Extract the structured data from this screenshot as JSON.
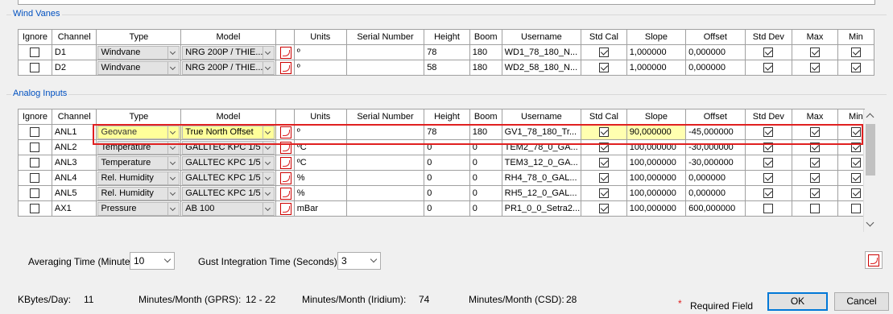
{
  "colors": {
    "highlight": "#e02020",
    "group_title": "#0050c0",
    "cell_yellow": "#ffff9a"
  },
  "wind_vanes": {
    "title": "Wind Vanes",
    "headers": [
      "Ignore",
      "Channel",
      "Type",
      "Model",
      "",
      "Units",
      "Serial Number",
      "Height",
      "Boom",
      "Username",
      "Std Cal",
      "Slope",
      "Offset",
      "Std Dev",
      "Max",
      "Min"
    ],
    "rows": [
      {
        "ignore": false,
        "channel": "D1",
        "type": "Windvane",
        "model": "NRG 200P / THIE...",
        "units": "º",
        "serial": "",
        "height": "78",
        "boom": "180",
        "username": "WD1_78_180_N...",
        "std_cal": true,
        "slope": "1,000000",
        "offset": "0,000000",
        "std_dev": true,
        "max": true,
        "min": true
      },
      {
        "ignore": false,
        "channel": "D2",
        "type": "Windvane",
        "model": "NRG 200P / THIE...",
        "units": "º",
        "serial": "",
        "height": "58",
        "boom": "180",
        "username": "WD2_58_180_N...",
        "std_cal": true,
        "slope": "1,000000",
        "offset": "0,000000",
        "std_dev": true,
        "max": true,
        "min": true
      }
    ]
  },
  "analog_inputs": {
    "title": "Analog Inputs",
    "headers": [
      "Ignore",
      "Channel",
      "Type",
      "Model",
      "",
      "Units",
      "Serial Number",
      "Height",
      "Boom",
      "Username",
      "Std Cal",
      "Slope",
      "Offset",
      "Std Dev",
      "Max",
      "Min"
    ],
    "rows": [
      {
        "ignore": false,
        "channel": "ANL1",
        "type": "Geovane",
        "model": "True North Offset",
        "units": "º",
        "serial": "",
        "height": "78",
        "boom": "180",
        "username": "GV1_78_180_Tr...",
        "std_cal": true,
        "slope": "90,000000",
        "offset": "-45,000000",
        "std_dev": true,
        "max": true,
        "min": true
      },
      {
        "ignore": false,
        "channel": "ANL2",
        "type": "Temperature",
        "model": "GALLTEC KPC 1/5",
        "units": "ºC",
        "serial": "",
        "height": "0",
        "boom": "0",
        "username": "TEM2_78_0_GA...",
        "std_cal": true,
        "slope": "100,000000",
        "offset": "-30,000000",
        "std_dev": true,
        "max": true,
        "min": true
      },
      {
        "ignore": false,
        "channel": "ANL3",
        "type": "Temperature",
        "model": "GALLTEC KPC 1/5",
        "units": "ºC",
        "serial": "",
        "height": "0",
        "boom": "0",
        "username": "TEM3_12_0_GA...",
        "std_cal": true,
        "slope": "100,000000",
        "offset": "-30,000000",
        "std_dev": true,
        "max": true,
        "min": true
      },
      {
        "ignore": false,
        "channel": "ANL4",
        "type": "Rel. Humidity",
        "model": "GALLTEC KPC 1/5",
        "units": "%",
        "serial": "",
        "height": "0",
        "boom": "0",
        "username": "RH4_78_0_GAL...",
        "std_cal": true,
        "slope": "100,000000",
        "offset": "0,000000",
        "std_dev": true,
        "max": true,
        "min": true
      },
      {
        "ignore": false,
        "channel": "ANL5",
        "type": "Rel. Humidity",
        "model": "GALLTEC KPC 1/5",
        "units": "%",
        "serial": "",
        "height": "0",
        "boom": "0",
        "username": "RH5_12_0_GAL...",
        "std_cal": true,
        "slope": "100,000000",
        "offset": "0,000000",
        "std_dev": true,
        "max": true,
        "min": true
      },
      {
        "ignore": false,
        "channel": "AX1",
        "type": "Pressure",
        "model": "AB 100",
        "units": "mBar",
        "serial": "",
        "height": "0",
        "boom": "0",
        "username": "PR1_0_0_Setra2...",
        "std_cal": true,
        "slope": "100,000000",
        "offset": "600,000000",
        "std_dev": false,
        "max": false,
        "min": false
      }
    ]
  },
  "averaging": {
    "label": "Averaging Time (Minutes)",
    "value": "10"
  },
  "gust": {
    "label": "Gust Integration Time (Seconds)",
    "value": "3"
  },
  "stats": {
    "kbytes_label": "KBytes/Day:",
    "kbytes_value": "11",
    "gprs_label": "Minutes/Month (GPRS):",
    "gprs_value": "12 - 22",
    "iridium_label": "Minutes/Month (Iridium):",
    "iridium_value": "74",
    "csd_label": "Minutes/Month (CSD):",
    "csd_value": "28"
  },
  "required": {
    "star": "*",
    "label": "Required Field"
  },
  "buttons": {
    "ok": "OK",
    "cancel": "Cancel"
  }
}
